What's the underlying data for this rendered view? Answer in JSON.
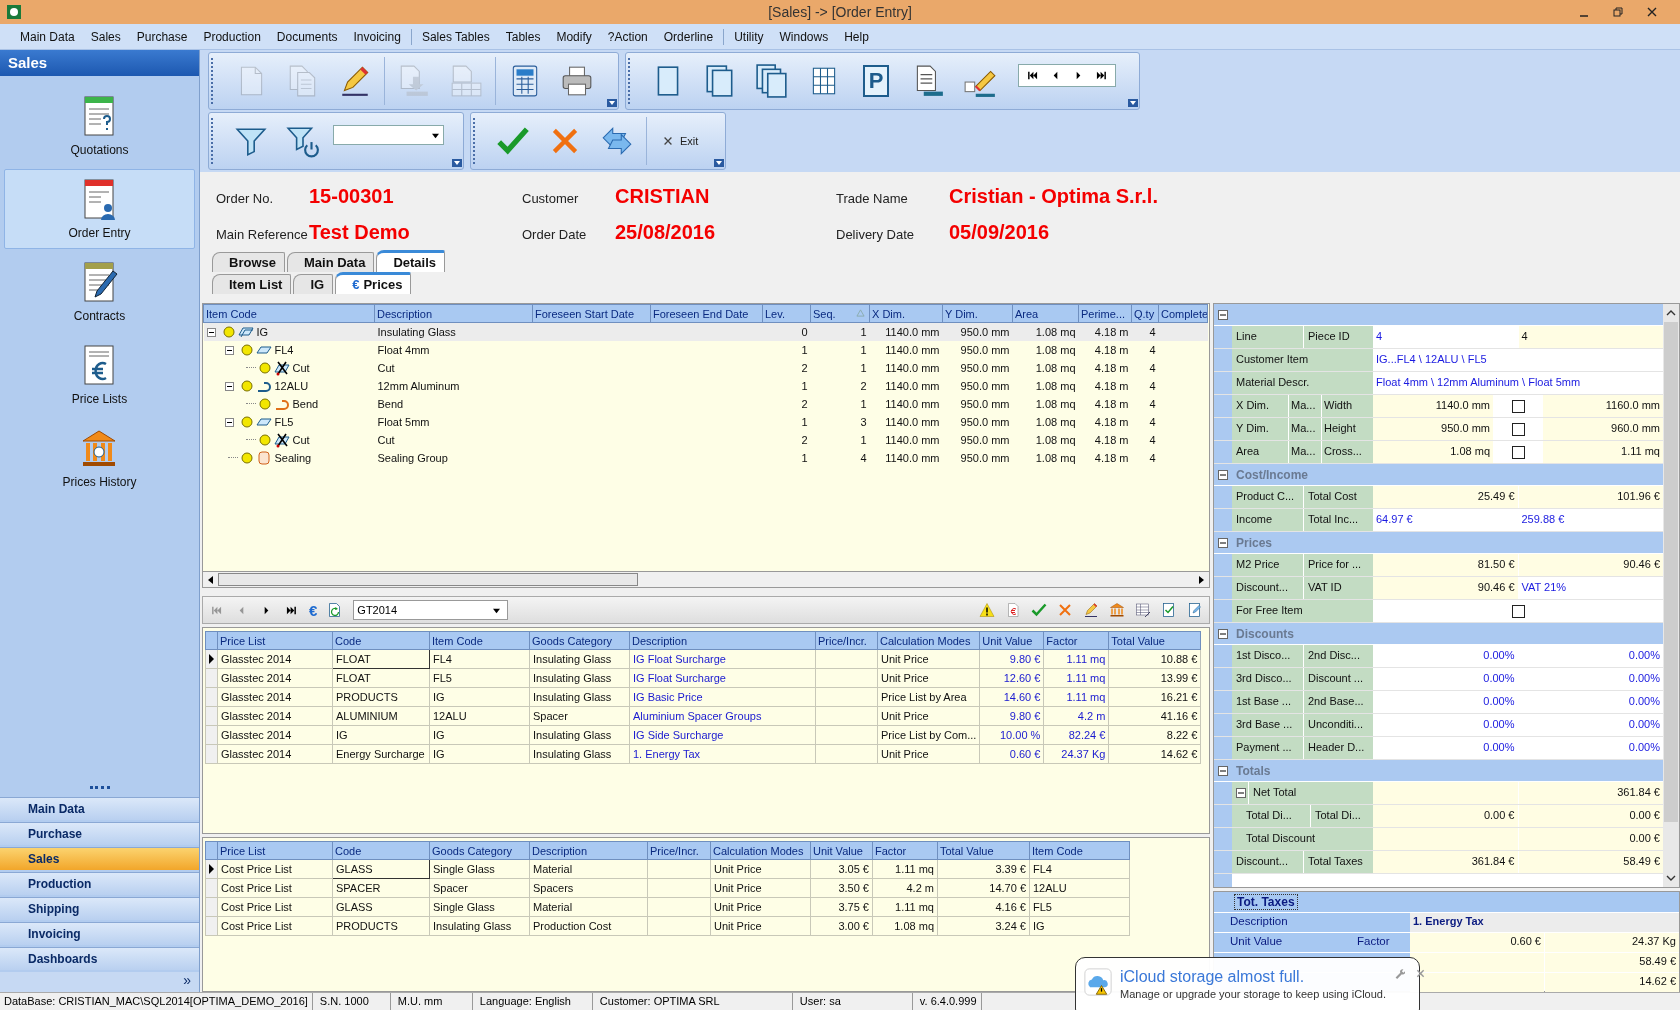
{
  "window": {
    "title": "[Sales] -> [Order Entry]"
  },
  "menu": [
    [
      "Main Data",
      "Sales",
      "Purchase",
      "Production",
      "Documents",
      "Invoicing"
    ],
    [
      "Sales Tables",
      "Tables",
      "Modify",
      "?Action",
      "Orderline"
    ],
    [
      "Utility",
      "Windows",
      "Help"
    ]
  ],
  "sidebar": {
    "title": "Sales",
    "items": [
      {
        "label": "Quotations",
        "kind": "quote",
        "selected": false
      },
      {
        "label": "Order Entry",
        "kind": "order",
        "selected": true
      },
      {
        "label": "Contracts",
        "kind": "contract",
        "selected": false
      },
      {
        "label": "Price Lists",
        "kind": "pricelist",
        "selected": false
      },
      {
        "label": "Prices History",
        "kind": "history",
        "selected": false
      }
    ],
    "modules": [
      {
        "label": "Main Data",
        "selected": false
      },
      {
        "label": "Purchase",
        "selected": false
      },
      {
        "label": "Sales",
        "selected": true
      },
      {
        "label": "Production",
        "selected": false
      },
      {
        "label": "Shipping",
        "selected": false
      },
      {
        "label": "Invoicing",
        "selected": false
      },
      {
        "label": "Dashboards",
        "selected": false
      }
    ],
    "more": "»"
  },
  "toolbar_rows": [
    [
      {
        "groups": [
          [
            {
              "kind": "page",
              "disabled": true
            },
            {
              "kind": "pages",
              "disabled": true
            },
            {
              "kind": "pencil",
              "disabled": false
            }
          ],
          [
            {
              "kind": "docin",
              "disabled": true
            },
            {
              "kind": "gridin",
              "disabled": true
            }
          ],
          [
            {
              "kind": "calc",
              "disabled": false
            },
            {
              "kind": "printer",
              "disabled": false
            }
          ]
        ]
      },
      {
        "groups": [
          [
            {
              "kind": "frame1",
              "disabled": false
            },
            {
              "kind": "frame2",
              "disabled": false
            },
            {
              "kind": "frame3",
              "disabled": false
            },
            {
              "kind": "grid",
              "disabled": false
            },
            {
              "kind": "letter",
              "label": "P",
              "disabled": false
            },
            {
              "kind": "doclines",
              "disabled": false
            },
            {
              "kind": "eraser",
              "disabled": false
            }
          ]
        ],
        "record_nav": [
          {
            "kind": "first",
            "disabled": false
          },
          {
            "kind": "prev",
            "disabled": false
          },
          {
            "kind": "next",
            "disabled": false
          },
          {
            "kind": "last",
            "disabled": false
          }
        ]
      }
    ],
    [
      {
        "groups": [
          [
            {
              "kind": "filter",
              "disabled": false
            },
            {
              "kind": "filterpower",
              "disabled": false
            },
            {
              "kind": "combo",
              "disabled": false
            }
          ]
        ]
      },
      {
        "groups": [
          [
            {
              "kind": "check",
              "disabled": false
            },
            {
              "kind": "cross",
              "disabled": false
            },
            {
              "kind": "sync",
              "disabled": false
            }
          ],
          [
            {
              "kind": "exit",
              "label": "Exit",
              "disabled": false
            }
          ]
        ]
      }
    ]
  ],
  "order": {
    "fields": [
      {
        "label": "Order No.",
        "value": "15-00301"
      },
      {
        "label": "Customer",
        "value": "CRISTIAN"
      },
      {
        "label": "Trade Name",
        "value": "Cristian - Optima S.r.l."
      },
      {
        "label": "Main Reference",
        "value": "Test Demo"
      },
      {
        "label": "Order Date",
        "value": "25/08/2016"
      },
      {
        "label": "Delivery Date",
        "value": "05/09/2016"
      }
    ]
  },
  "tabs": [
    {
      "label": "Browse",
      "selected": false
    },
    {
      "label": "Main Data",
      "selected": false
    },
    {
      "label": "Details",
      "selected": true
    }
  ],
  "subtabs": [
    {
      "label": "Item List",
      "selected": false
    },
    {
      "label": "IG",
      "selected": false
    },
    {
      "label": "Prices",
      "icon": "€",
      "selected": true
    }
  ],
  "item_tree": {
    "columns": [
      {
        "label": "Item Code",
        "sorted": false
      },
      {
        "label": "Description",
        "sorted": false
      },
      {
        "label": "Foreseen Start Date",
        "sorted": false
      },
      {
        "label": "Foreseen End Date",
        "sorted": false
      },
      {
        "label": "Lev.",
        "sorted": false
      },
      {
        "label": "Seq.",
        "sorted": true
      },
      {
        "label": "X Dim.",
        "sorted": false
      },
      {
        "label": "Y Dim.",
        "sorted": false
      },
      {
        "label": "Area",
        "sorted": false
      },
      {
        "label": "Perime...",
        "sorted": false
      },
      {
        "label": "Q.ty",
        "sorted": false
      },
      {
        "label": "Complete",
        "sorted": false
      }
    ],
    "rows": [
      {
        "code": "IG",
        "kind": "ig",
        "description": "Insulating Glass",
        "lev": "0",
        "seq": "1",
        "x_dim": "1140.0 mm",
        "y_dim": "950.0 mm",
        "area": "1.08 mq",
        "perimeter": "4.18 m",
        "qty": "4",
        "selected": true,
        "expanded": true,
        "children": [
          {
            "code": "FL4",
            "kind": "float",
            "description": "Float 4mm",
            "lev": "1",
            "seq": "1",
            "x_dim": "1140.0 mm",
            "y_dim": "950.0 mm",
            "area": "1.08 mq",
            "perimeter": "4.18 m",
            "qty": "4",
            "selected": false,
            "expanded": true,
            "children": [
              {
                "code": "Cut",
                "kind": "cut",
                "description": "Cut",
                "lev": "2",
                "seq": "1",
                "x_dim": "1140.0 mm",
                "y_dim": "950.0 mm",
                "area": "1.08 mq",
                "perimeter": "4.18 m",
                "qty": "4",
                "selected": false
              }
            ]
          },
          {
            "code": "12ALU",
            "kind": "spacer",
            "description": "12mm Aluminum",
            "lev": "1",
            "seq": "2",
            "x_dim": "1140.0 mm",
            "y_dim": "950.0 mm",
            "area": "1.08 mq",
            "perimeter": "4.18 m",
            "qty": "4",
            "selected": false,
            "expanded": true,
            "children": [
              {
                "code": "Bend",
                "kind": "bend",
                "description": "Bend",
                "lev": "2",
                "seq": "1",
                "x_dim": "1140.0 mm",
                "y_dim": "950.0 mm",
                "area": "1.08 mq",
                "perimeter": "4.18 m",
                "qty": "4",
                "selected": false
              }
            ]
          },
          {
            "code": "FL5",
            "kind": "float",
            "description": "Float 5mm",
            "lev": "1",
            "seq": "3",
            "x_dim": "1140.0 mm",
            "y_dim": "950.0 mm",
            "area": "1.08 mq",
            "perimeter": "4.18 m",
            "qty": "4",
            "selected": false,
            "expanded": true,
            "children": [
              {
                "code": "Cut",
                "kind": "cut",
                "description": "Cut",
                "lev": "2",
                "seq": "1",
                "x_dim": "1140.0 mm",
                "y_dim": "950.0 mm",
                "area": "1.08 mq",
                "perimeter": "4.18 m",
                "qty": "4",
                "selected": false
              }
            ]
          },
          {
            "code": "Sealing",
            "kind": "sealing",
            "description": "Sealing Group",
            "lev": "1",
            "seq": "4",
            "x_dim": "1140.0 mm",
            "y_dim": "950.0 mm",
            "area": "1.08 mq",
            "perimeter": "4.18 m",
            "qty": "4",
            "selected": false
          }
        ]
      }
    ]
  },
  "record_toolbar": {
    "nav": [
      {
        "kind": "first",
        "disabled": true
      },
      {
        "kind": "prev",
        "disabled": true
      },
      {
        "kind": "next",
        "disabled": false
      },
      {
        "kind": "last",
        "disabled": false
      }
    ],
    "currency": "€",
    "price_list": "GT2014",
    "tools": [
      {
        "kind": "warning"
      },
      {
        "kind": "doceuro"
      },
      {
        "kind": "check"
      },
      {
        "kind": "cross"
      },
      {
        "kind": "pencil"
      },
      {
        "kind": "bank"
      },
      {
        "kind": "table"
      },
      {
        "kind": "checkdoc"
      },
      {
        "kind": "editdoc"
      }
    ]
  },
  "price_grid": {
    "columns": [
      "Price List",
      "Code",
      "Item Code",
      "Goods Category",
      "Description",
      "Price/Incr.",
      "Calculation Modes",
      "Unit Value",
      "Factor",
      "Total Value"
    ],
    "rows": [
      {
        "selected": true,
        "price_list": "Glasstec 2014",
        "code": "FLOAT",
        "item_code": "FL4",
        "goods_category": "Insulating Glass",
        "description": "IG Float Surcharge",
        "calc_mode": "Unit Price",
        "unit_value": "9.80 €",
        "factor": "1.11 mq",
        "total_value": "10.88 €"
      },
      {
        "selected": false,
        "price_list": "Glasstec 2014",
        "code": "FLOAT",
        "item_code": "FL5",
        "goods_category": "Insulating Glass",
        "description": "IG Float Surcharge",
        "calc_mode": "Unit Price",
        "unit_value": "12.60 €",
        "factor": "1.11 mq",
        "total_value": "13.99 €"
      },
      {
        "selected": false,
        "price_list": "Glasstec 2014",
        "code": "PRODUCTS",
        "item_code": "IG",
        "goods_category": "Insulating Glass",
        "description": "IG Basic Price",
        "calc_mode": "Price List by Area",
        "unit_value": "14.60 €",
        "factor": "1.11 mq",
        "total_value": "16.21 €"
      },
      {
        "selected": false,
        "price_list": "Glasstec 2014",
        "code": "ALUMINIUM",
        "item_code": "12ALU",
        "goods_category": "Spacer",
        "description": "Aluminium Spacer Groups",
        "calc_mode": "Unit Price",
        "unit_value": "9.80 €",
        "factor": "4.2 m",
        "total_value": "41.16 €"
      },
      {
        "selected": false,
        "price_list": "Glasstec 2014",
        "code": "IG",
        "item_code": "IG",
        "goods_category": "Insulating Glass",
        "description": "IG Side Surcharge",
        "calc_mode": "Price List by Com...",
        "unit_value": "10.00 %",
        "factor": "82.24 €",
        "total_value": "8.22 €"
      },
      {
        "selected": false,
        "price_list": "Glasstec 2014",
        "code": "Energy Surcharge",
        "item_code": "IG",
        "goods_category": "Insulating Glass",
        "description": "1. Energy Tax",
        "calc_mode": "Unit Price",
        "unit_value": "0.60 €",
        "factor": "24.37 Kg",
        "total_value": "14.62 €"
      }
    ]
  },
  "cost_grid": {
    "columns": [
      "Price List",
      "Code",
      "Goods Category",
      "Description",
      "Price/Incr.",
      "Calculation Modes",
      "Unit Value",
      "Factor",
      "Total Value",
      "Item Code"
    ],
    "rows": [
      {
        "selected": true,
        "price_list": "Cost Price List",
        "code": "GLASS",
        "goods_category": "Single Glass",
        "description": "Material",
        "calc_mode": "Unit Price",
        "unit_value": "3.05 €",
        "factor": "1.11 mq",
        "total_value": "3.39 €",
        "item_code": "FL4"
      },
      {
        "selected": false,
        "price_list": "Cost Price List",
        "code": "SPACER",
        "goods_category": "Spacer",
        "description": "Spacers",
        "calc_mode": "Unit Price",
        "unit_value": "3.50 €",
        "factor": "4.2 m",
        "total_value": "14.70 €",
        "item_code": "12ALU"
      },
      {
        "selected": false,
        "price_list": "Cost Price List",
        "code": "GLASS",
        "goods_category": "Single Glass",
        "description": "Material",
        "calc_mode": "Unit Price",
        "unit_value": "3.75 €",
        "factor": "1.11 mq",
        "total_value": "4.16 €",
        "item_code": "FL5"
      },
      {
        "selected": false,
        "price_list": "Cost Price List",
        "code": "PRODUCTS",
        "goods_category": "Insulating Glass",
        "description": "Production Cost",
        "calc_mode": "Unit Price",
        "unit_value": "3.00 €",
        "factor": "1.08 mq",
        "total_value": "3.24 €",
        "item_code": "IG"
      }
    ]
  },
  "prop_panel": {
    "sections": [
      {
        "expanded": true,
        "rows": [
          {
            "labels": [
              "Line",
              "Piece ID"
            ],
            "cells": [
              {
                "kind": "blue",
                "text": "4"
              },
              {
                "kind": "text",
                "text": "4"
              }
            ]
          },
          {
            "labels": [
              "Customer Item"
            ],
            "cells": [
              {
                "kind": "blue",
                "text": "IG...FL4 \\ 12ALU \\ FL5"
              }
            ]
          },
          {
            "labels": [
              "Material Descr."
            ],
            "cells": [
              {
                "kind": "blue",
                "text": "Float 4mm \\ 12mm Aluminum \\ Float 5mm"
              }
            ]
          },
          {
            "labels": [
              "X Dim.",
              "Ma...",
              "Width"
            ],
            "cells": [
              {
                "kind": "num",
                "text": "1140.0 mm"
              },
              {
                "kind": "check",
                "checked": false
              },
              {
                "kind": "num",
                "text": "1160.0 mm"
              }
            ]
          },
          {
            "labels": [
              "Y Dim.",
              "Ma...",
              "Height"
            ],
            "cells": [
              {
                "kind": "num",
                "text": "950.0 mm"
              },
              {
                "kind": "check",
                "checked": false
              },
              {
                "kind": "num",
                "text": "960.0 mm"
              }
            ]
          },
          {
            "labels": [
              "Area",
              "Ma...",
              "Cross..."
            ],
            "cells": [
              {
                "kind": "num",
                "text": "1.08 mq"
              },
              {
                "kind": "check",
                "checked": false
              },
              {
                "kind": "num",
                "text": "1.11 mq"
              }
            ]
          }
        ]
      },
      {
        "title": "Cost/Income",
        "expanded": true,
        "rows": [
          {
            "labels": [
              "Product C...",
              "Total Cost"
            ],
            "cells": [
              {
                "kind": "num",
                "text": "25.49 €"
              },
              {
                "kind": "num",
                "text": "101.96 €"
              }
            ]
          },
          {
            "labels": [
              "Income",
              "Total Inc..."
            ],
            "cells": [
              {
                "kind": "blue",
                "text": "64.97 €"
              },
              {
                "kind": "blue",
                "text": "259.88 €"
              }
            ]
          }
        ]
      },
      {
        "title": "Prices",
        "expanded": true,
        "rows": [
          {
            "labels": [
              "M2 Price",
              "Price for ..."
            ],
            "cells": [
              {
                "kind": "num",
                "text": "81.50 €"
              },
              {
                "kind": "num",
                "text": "90.46 €"
              }
            ]
          },
          {
            "labels": [
              "Discount...",
              "VAT ID"
            ],
            "cells": [
              {
                "kind": "num",
                "text": "90.46 €"
              },
              {
                "kind": "blue",
                "text": "VAT 21%"
              }
            ]
          },
          {
            "labels": [
              "For Free Item"
            ],
            "cells": [
              {
                "kind": "check",
                "checked": false
              }
            ]
          }
        ]
      },
      {
        "title": "Discounts",
        "expanded": true,
        "rows": [
          {
            "labels": [
              "1st Disco...",
              "2nd Disc..."
            ],
            "cells": [
              {
                "kind": "bluenum",
                "text": "0.00%"
              },
              {
                "kind": "bluenum",
                "text": "0.00%"
              }
            ]
          },
          {
            "labels": [
              "3rd Disco...",
              "Discount ..."
            ],
            "cells": [
              {
                "kind": "bluenum",
                "text": "0.00%"
              },
              {
                "kind": "bluenum",
                "text": "0.00%"
              }
            ]
          },
          {
            "labels": [
              "1st Base ...",
              "2nd Base..."
            ],
            "cells": [
              {
                "kind": "bluenum",
                "text": "0.00%"
              },
              {
                "kind": "bluenum",
                "text": "0.00%"
              }
            ]
          },
          {
            "labels": [
              "3rd Base ...",
              "Unconditi..."
            ],
            "cells": [
              {
                "kind": "bluenum",
                "text": "0.00%"
              },
              {
                "kind": "bluenum",
                "text": "0.00%"
              }
            ]
          },
          {
            "labels": [
              "Payment ...",
              "Header D..."
            ],
            "cells": [
              {
                "kind": "bluenum",
                "text": "0.00%"
              },
              {
                "kind": "bluenum",
                "text": "0.00%"
              }
            ]
          }
        ]
      },
      {
        "title": "Totals",
        "expanded": true,
        "rows": [
          {
            "labels": [
              "Net Total"
            ],
            "cells": [
              {
                "kind": "num",
                "text": ""
              },
              {
                "kind": "num",
                "text": "361.84 €"
              }
            ],
            "expanded": true,
            "children": [
              {
                "labels": [
                  "Total Di...",
                  "Total Di..."
                ],
                "cells": [
                  {
                    "kind": "num",
                    "text": "0.00 €"
                  },
                  {
                    "kind": "num",
                    "text": "0.00 €"
                  }
                ]
              },
              {
                "labels": [
                  "Total Discount"
                ],
                "cells": [
                  {
                    "kind": "num",
                    "text": ""
                  },
                  {
                    "kind": "num",
                    "text": "0.00 €"
                  }
                ]
              }
            ]
          },
          {
            "labels": [
              "Discount...",
              "Total Taxes"
            ],
            "cells": [
              {
                "kind": "num",
                "text": "361.84 €"
              },
              {
                "kind": "num",
                "text": "58.49 €"
              }
            ]
          }
        ]
      }
    ]
  },
  "tax_panel": {
    "title": "Tot. Taxes",
    "rows": [
      {
        "labels": [
          "Description"
        ],
        "cells": [
          {
            "kind": "title",
            "text": "1. Energy Tax"
          }
        ]
      },
      {
        "labels": [
          "Unit Value",
          "Factor"
        ],
        "cells": [
          {
            "kind": "num",
            "text": "0.60 €"
          },
          {
            "kind": "num",
            "text": "24.37 Kg"
          }
        ]
      },
      {
        "cells": [
          {
            "kind": "num",
            "text": ""
          },
          {
            "kind": "num",
            "text": "58.49 €"
          }
        ]
      },
      {
        "cells": [
          {
            "kind": "num",
            "text": ""
          },
          {
            "kind": "num",
            "text": "14.62 €"
          }
        ]
      }
    ]
  },
  "status_bar": [
    "DataBase: CRISTIAN_MAC\\SQL2014[OPTIMA_DEMO_2016]",
    "S.N. 1000",
    "M.U. mm",
    "Language: English",
    "Customer: OPTIMA SRL",
    "User: sa",
    "v. 6.4.0.999"
  ],
  "notification": {
    "title": "iCloud storage almost full.",
    "message": "Manage or upgrade your storage to keep using iCloud."
  }
}
